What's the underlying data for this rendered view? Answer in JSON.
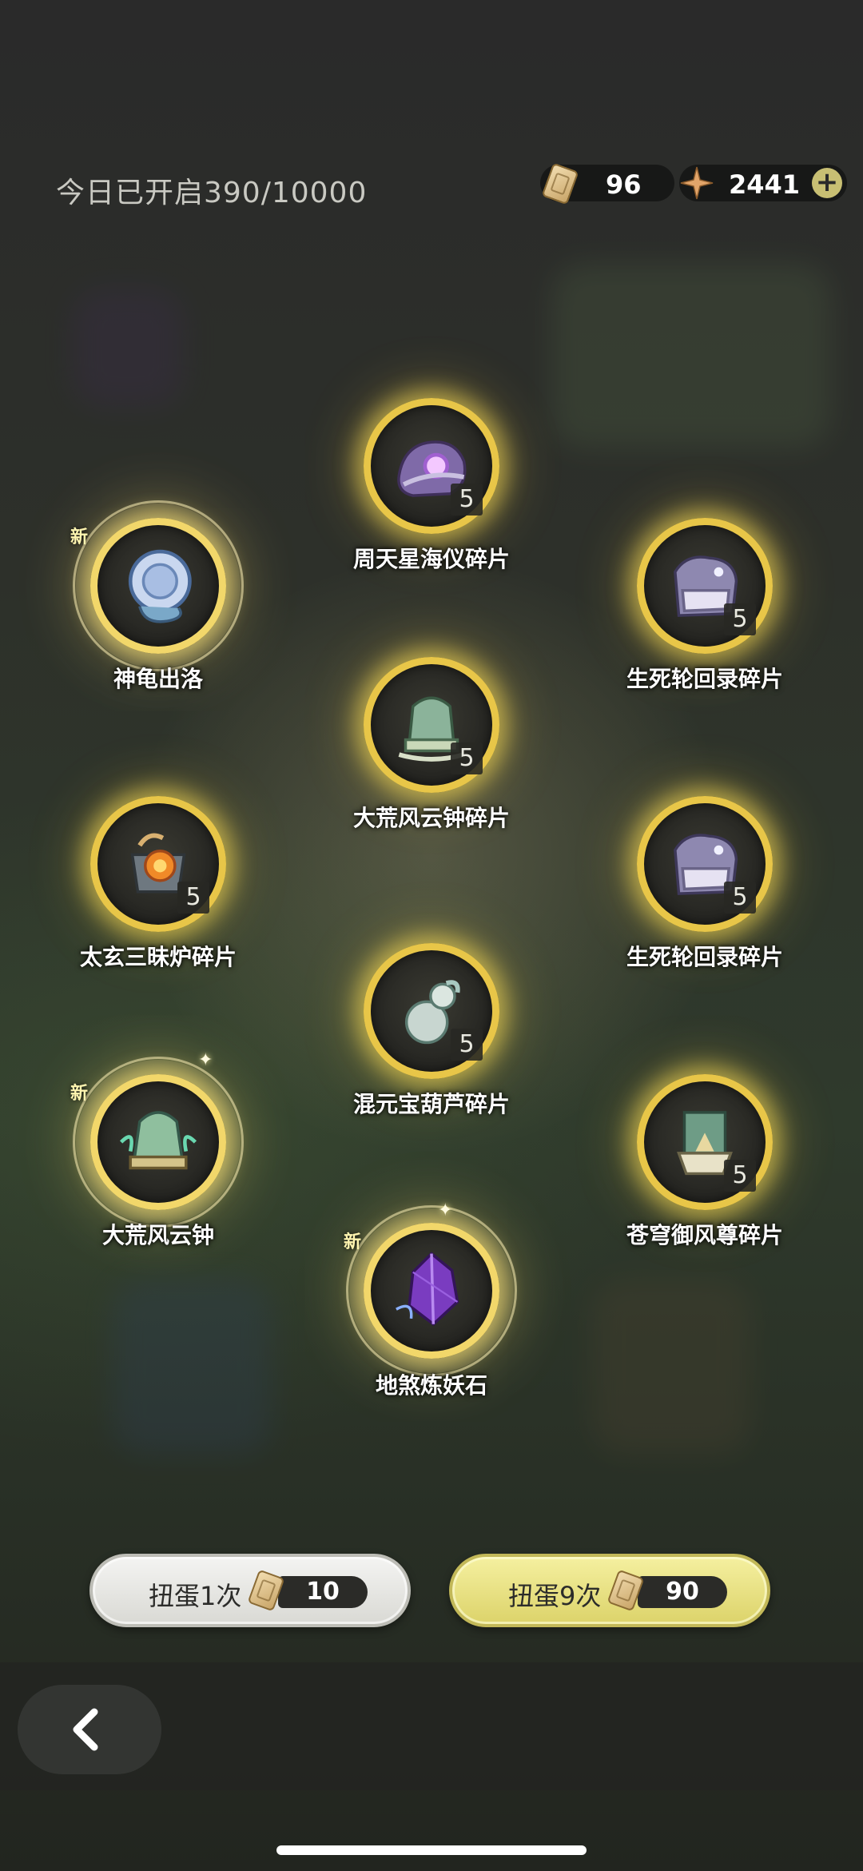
{
  "header": {
    "today_opened": "今日已开启390/10000",
    "tickets": "96",
    "stars": "2441",
    "plus_label": "+"
  },
  "items": [
    {
      "name": "周天星海仪碎片",
      "count": "5",
      "new": ""
    },
    {
      "name": "神龟出洛",
      "count": "",
      "new": "新"
    },
    {
      "name": "生死轮回录碎片",
      "count": "5",
      "new": ""
    },
    {
      "name": "大荒风云钟碎片",
      "count": "5",
      "new": ""
    },
    {
      "name": "太玄三昧炉碎片",
      "count": "5",
      "new": ""
    },
    {
      "name": "生死轮回录碎片",
      "count": "5",
      "new": ""
    },
    {
      "name": "混元宝葫芦碎片",
      "count": "5",
      "new": ""
    },
    {
      "name": "大荒风云钟",
      "count": "",
      "new": "新"
    },
    {
      "name": "苍穹御风尊碎片",
      "count": "5",
      "new": ""
    },
    {
      "name": "地煞炼妖石",
      "count": "",
      "new": "新"
    }
  ],
  "buttons": {
    "draw_once": {
      "label": "扭蛋1次",
      "cost": "10"
    },
    "draw_nine": {
      "label": "扭蛋9次",
      "cost": "90"
    }
  },
  "icons": {
    "back": "back-arrow-icon",
    "ticket": "ticket-icon",
    "star": "four-point-star-icon"
  },
  "colors": {
    "orb_border": "#e8c648",
    "primary_button": "#dcd36a",
    "secondary_button": "#d9d9d4"
  }
}
